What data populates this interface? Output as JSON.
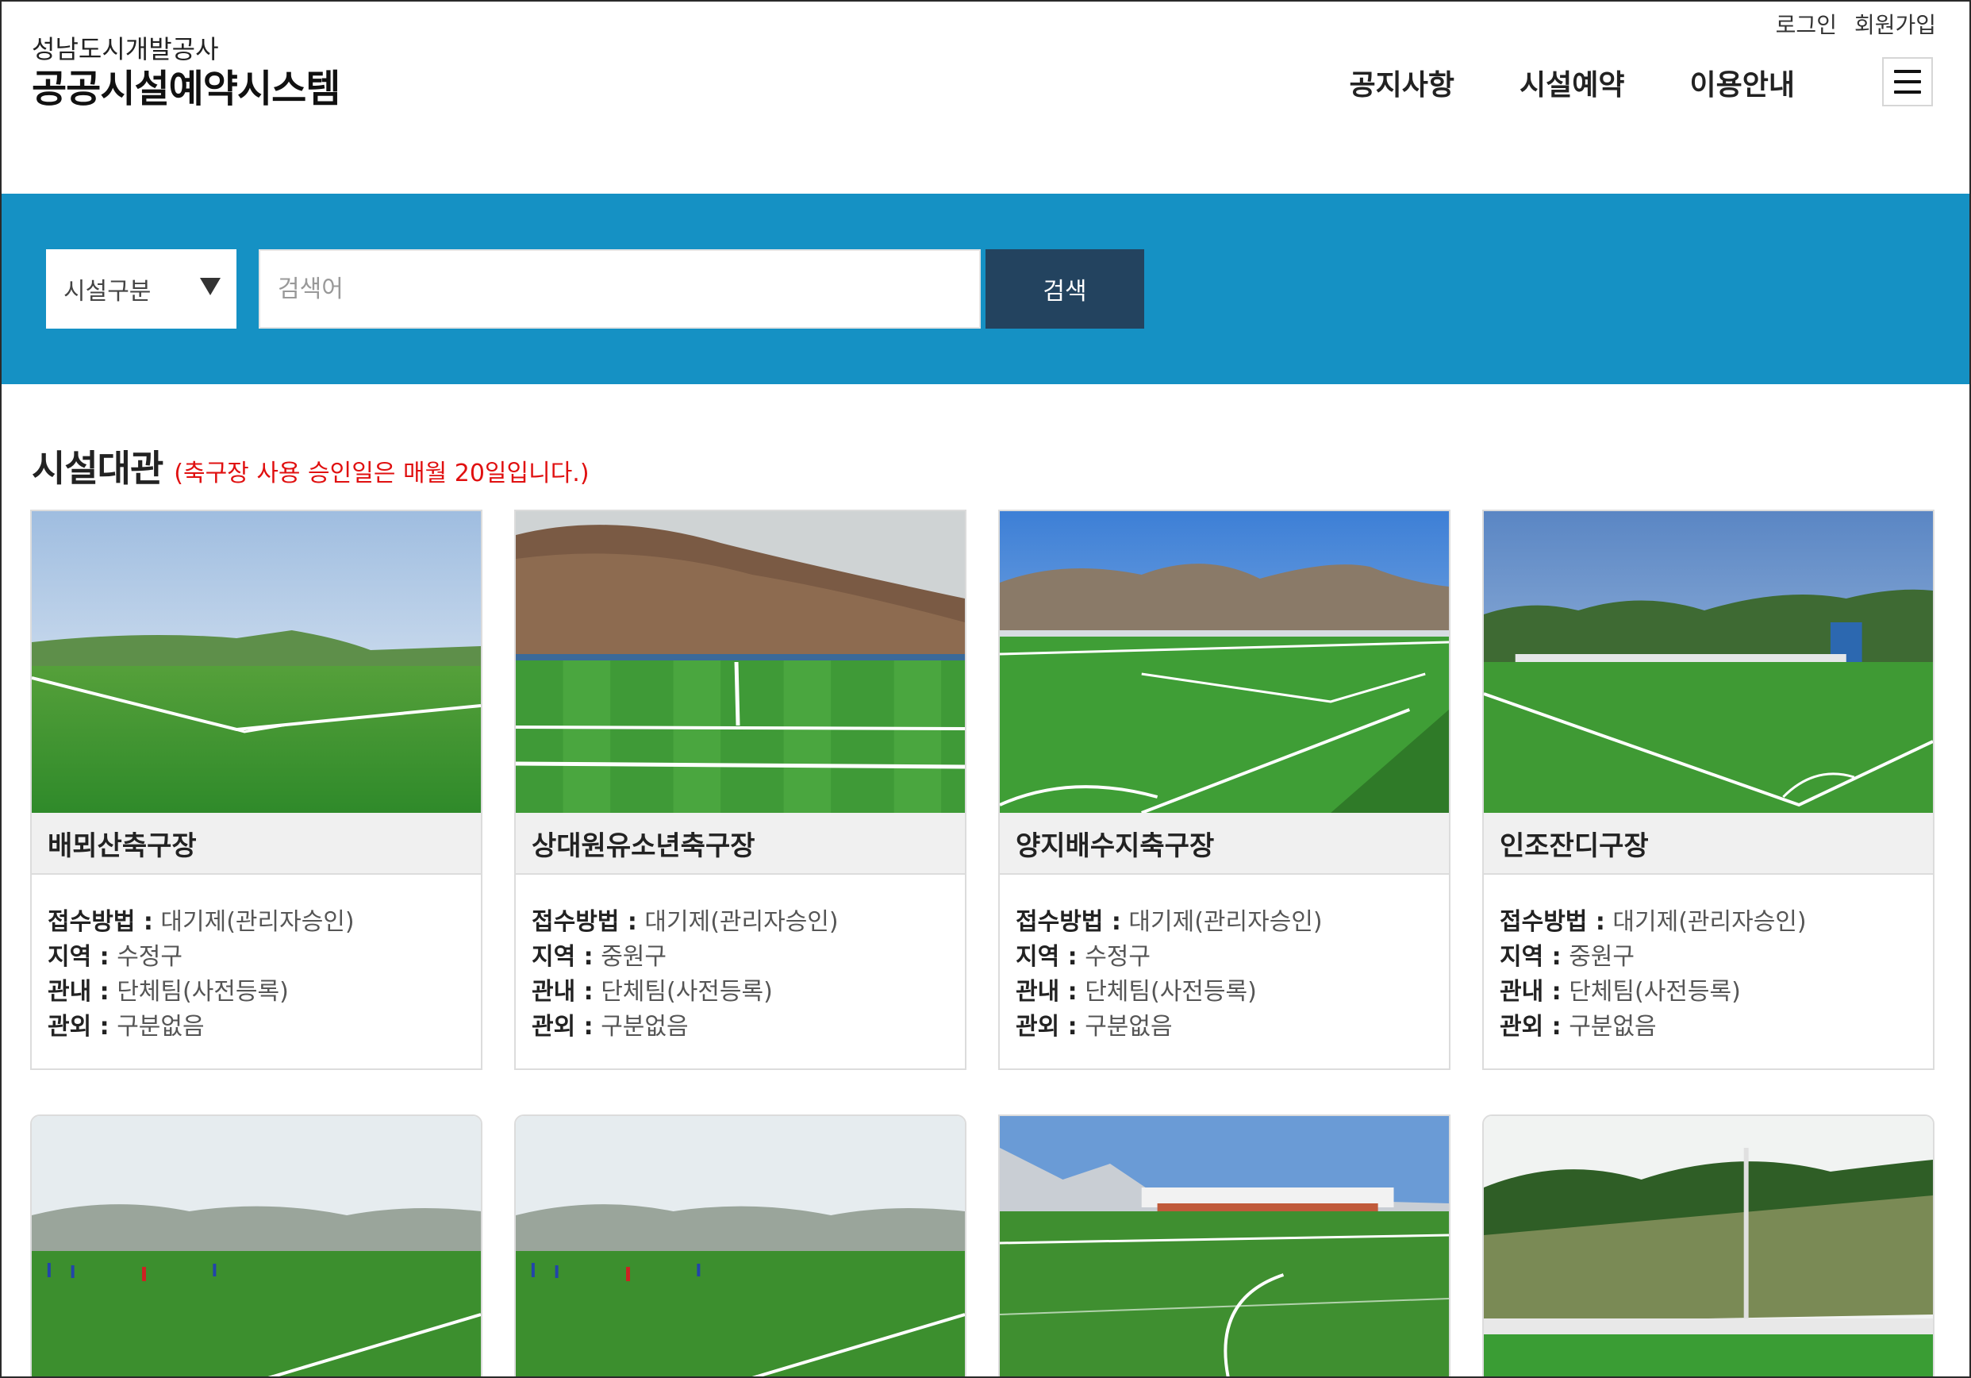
{
  "header": {
    "org": "성남도시개발공사",
    "title": "공공시설예약시스템",
    "top_links": {
      "login": "로그인",
      "signup": "회원가입"
    },
    "nav": [
      "공지사항",
      "시설예약",
      "이용안내"
    ]
  },
  "search": {
    "category_label": "시설구분",
    "placeholder": "검색어",
    "button": "검색"
  },
  "section": {
    "title": "시설대관",
    "notice": "(축구장 사용 승인일은 매월 20일입니다.)"
  },
  "info_labels": {
    "method": "접수방법 :",
    "region": "지역 :",
    "inside": "관내 :",
    "outside": "관외 :"
  },
  "facilities": [
    {
      "name": "배뫼산축구장",
      "method": "대기제(관리자승인)",
      "region": "수정구",
      "inside": "단체팀(사전등록)",
      "outside": "구분없음"
    },
    {
      "name": "상대원유소년축구장",
      "method": "대기제(관리자승인)",
      "region": "중원구",
      "inside": "단체팀(사전등록)",
      "outside": "구분없음"
    },
    {
      "name": "양지배수지축구장",
      "method": "대기제(관리자승인)",
      "region": "수정구",
      "inside": "단체팀(사전등록)",
      "outside": "구분없음"
    },
    {
      "name": "인조잔디구장",
      "method": "대기제(관리자승인)",
      "region": "중원구",
      "inside": "단체팀(사전등록)",
      "outside": "구분없음"
    }
  ],
  "colors": {
    "band": "#1591c4",
    "search_button": "#23435f",
    "notice": "#e01010"
  }
}
